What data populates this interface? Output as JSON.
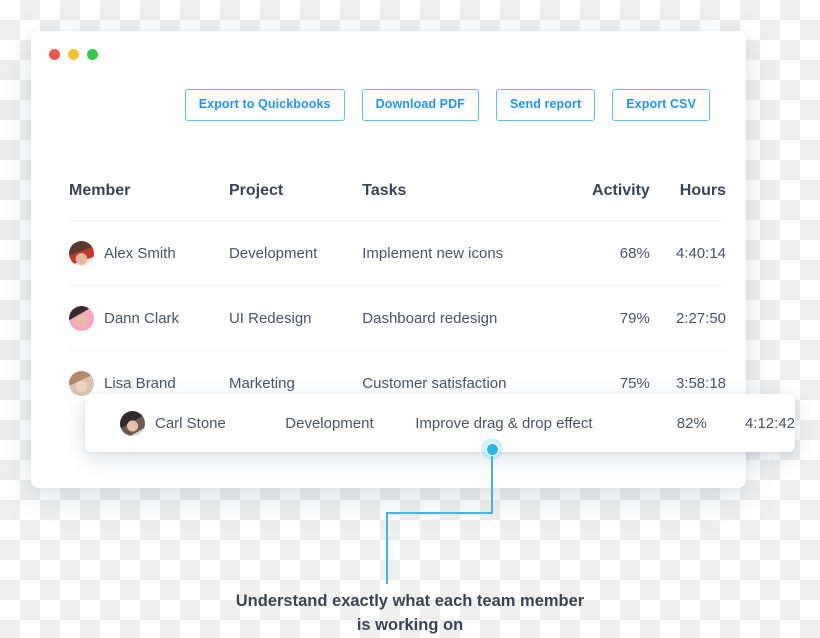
{
  "window": {
    "dots": [
      "close-red",
      "minimize-yellow",
      "maximize-green"
    ]
  },
  "toolbar": {
    "buttons": [
      {
        "label": "Export to Quickbooks",
        "name": "export-quickbooks-button"
      },
      {
        "label": "Download PDF",
        "name": "download-pdf-button"
      },
      {
        "label": "Send report",
        "name": "send-report-button"
      },
      {
        "label": "Export CSV",
        "name": "export-csv-button"
      }
    ]
  },
  "table": {
    "headers": {
      "member": "Member",
      "project": "Project",
      "tasks": "Tasks",
      "activity": "Activity",
      "hours": "Hours"
    },
    "rows": [
      {
        "member": "Alex Smith",
        "project": "Development",
        "task": "Implement new icons",
        "activity": "68%",
        "hours": "4:40:14"
      },
      {
        "member": "Dann Clark",
        "project": "UI Redesign",
        "task": "Dashboard redesign",
        "activity": "79%",
        "hours": "2:27:50"
      },
      {
        "member": "Lisa Brand",
        "project": "Marketing",
        "task": "Customer satisfaction",
        "activity": "75%",
        "hours": "3:58:18"
      }
    ],
    "highlighted_row": {
      "member": "Carl Stone",
      "project": "Development",
      "task": "Improve drag & drop effect",
      "activity": "82%",
      "hours": "4:12:42"
    }
  },
  "callout": {
    "line1": "Understand exactly what each team member",
    "line2": "is working on"
  },
  "colors": {
    "accent_blue": "#2196e8",
    "border_blue": "#5cc0ea",
    "pin_blue": "#2fb3ec",
    "text_dark": "#3b4453",
    "text_body": "#4a5263",
    "dot_red": "#f9524b",
    "dot_yellow": "#fbbe2e",
    "dot_green": "#2ecb4f"
  }
}
